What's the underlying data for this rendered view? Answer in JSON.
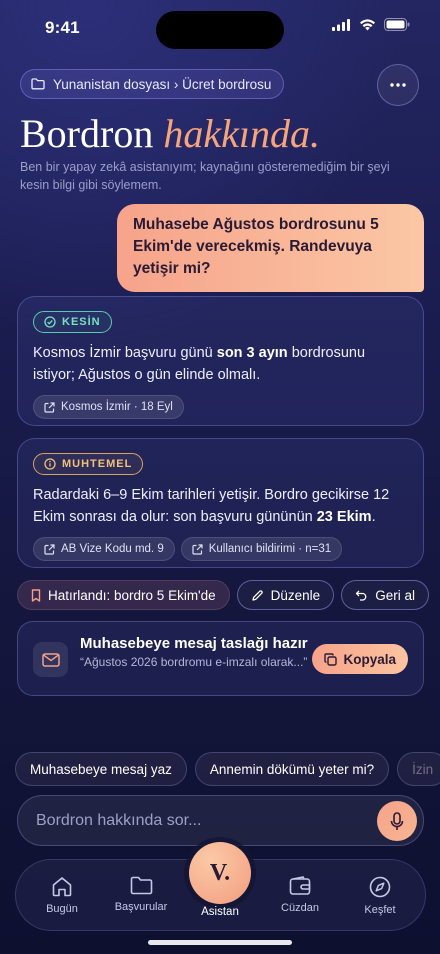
{
  "status": {
    "time": "9:41"
  },
  "breadcrumb": "Yunanistan dosyası › Ücret bordrosu",
  "header": {
    "title_main": "Bordron",
    "title_accent": "hakkında.",
    "subtitle": "Ben bir yapay zekâ asistanıyım; kaynağını gösteremediğim bir şeyi kesin bilgi gibi söylemem."
  },
  "user_message": "Muhasebe Ağustos bordrosunu 5 Ekim'de verecekmiş. Randevuya yetişir mi?",
  "card1": {
    "badge": "KESİN",
    "text_a": "Kosmos İzmir başvuru günü ",
    "text_b": "son 3 ayın",
    "text_c": " bordrosunu istiyor; Ağustos o gün elinde olmalı.",
    "sources": [
      "Kosmos İzmir · 18 Eyl"
    ]
  },
  "card2": {
    "badge": "MUHTEMEL",
    "text_a": "Radardaki 6–9 Ekim tarihleri yetişir. Bordro gecikirse 12 Ekim sonrası da olur: son başvuru gününün ",
    "text_b": "23 Ekim",
    "text_c": ".",
    "sources": [
      "AB Vize Kodu md. 9",
      "Kullanıcı bildirimi · n=31"
    ]
  },
  "actions": {
    "reminder": "Hatırlandı: bordro 5 Ekim'de",
    "edit": "Düzenle",
    "undo": "Geri al"
  },
  "draft": {
    "title": "Muhasebeye mesaj taslağı hazır",
    "preview": "“Ağustos 2026 bordromu e-imzalı olarak...”",
    "copy": "Kopyala"
  },
  "suggestions": [
    "Muhasebeye mesaj yaz",
    "Annemin dökümü yeter mi?",
    "İzin"
  ],
  "input": {
    "placeholder": "Bordron hakkında sor..."
  },
  "tabs": {
    "t1": "Bugün",
    "t2": "Başvurular",
    "center": "Asistan",
    "center_logo": "V.",
    "t4": "Cüzdan",
    "t5": "Keşfet"
  },
  "colors": {
    "accent": "#f6a38a",
    "success": "#7ce0c2",
    "warning": "#f3c07a"
  }
}
